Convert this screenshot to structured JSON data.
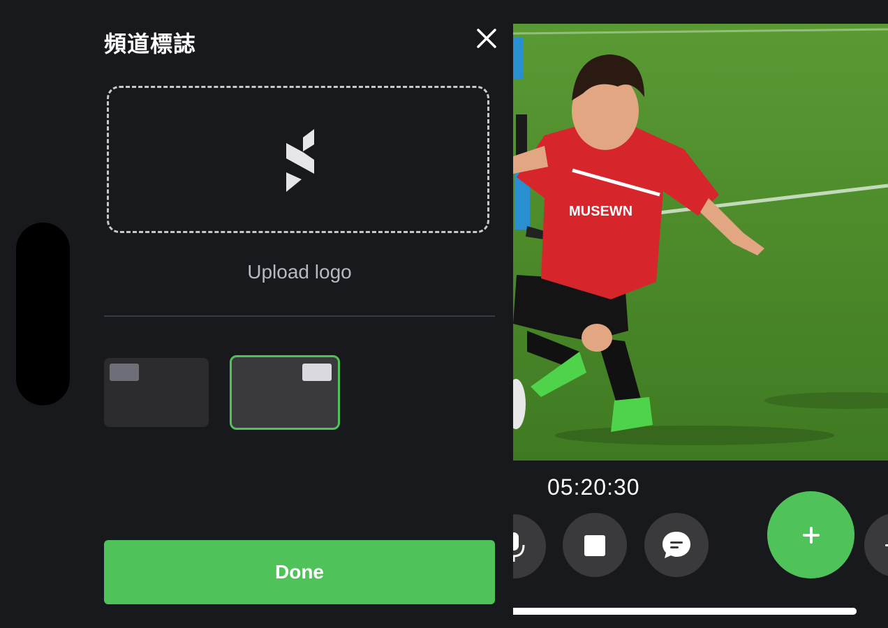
{
  "sheet": {
    "title": "頻道標誌",
    "upload_label": "Upload logo",
    "done_label": "Done",
    "position_options": [
      {
        "name": "top-left",
        "selected": false
      },
      {
        "name": "top-right",
        "selected": true
      }
    ]
  },
  "recorder": {
    "timer": "05:20:30",
    "controls": [
      "mic-icon",
      "stop-icon",
      "chat-icon",
      "plus-icon"
    ]
  },
  "colors": {
    "accent": "#4fc35a",
    "background": "#18191d",
    "control": "#3a3a3c"
  }
}
